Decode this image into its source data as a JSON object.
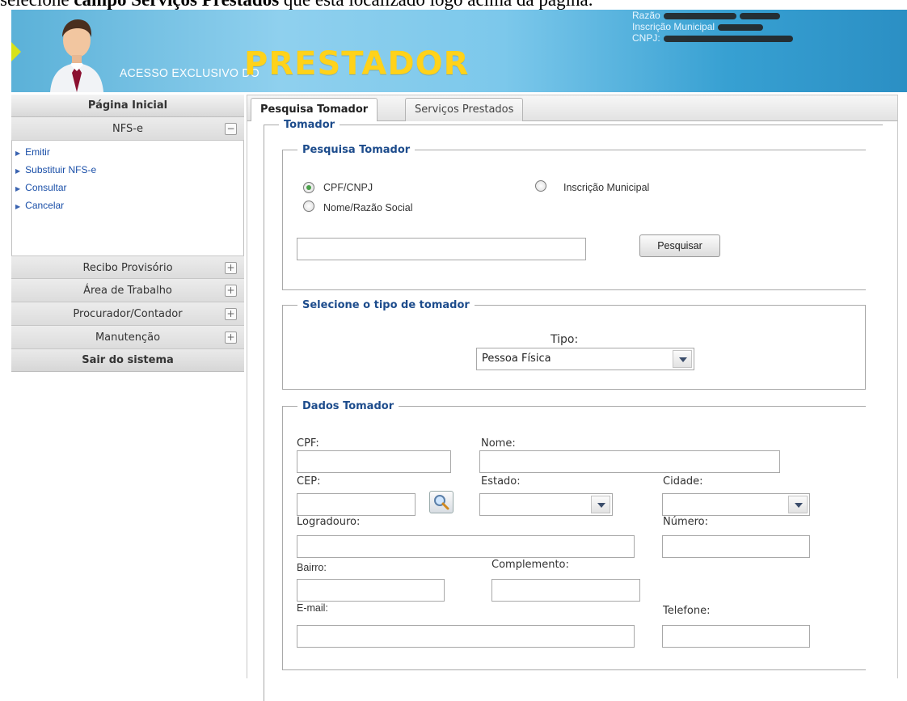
{
  "caption": {
    "prefix": "selecione ",
    "bold": "campo Serviços Prestados",
    "suffix": " que está localizado logo acima da página."
  },
  "banner": {
    "tagline": "ACESSO EXCLUSIVO DO",
    "brand": "PRESTADOR",
    "info": [
      "Razão",
      "Inscrição Municipal",
      "CNPJ:"
    ]
  },
  "sidebar": {
    "home": "Página Inicial",
    "nfse": {
      "label": "NFS-e",
      "toggle": "−"
    },
    "nfse_links": [
      "Emitir",
      "Substituir NFS-e",
      "Consultar",
      "Cancelar"
    ],
    "sections": [
      {
        "label": "Recibo Provisório",
        "toggle": "+"
      },
      {
        "label": "Área de Trabalho",
        "toggle": "+"
      },
      {
        "label": "Procurador/Contador",
        "toggle": "+"
      },
      {
        "label": "Manutenção",
        "toggle": "+"
      }
    ],
    "exit": "Sair do sistema"
  },
  "tabs": {
    "active": "Pesquisa Tomador",
    "other": "Serviços Prestados"
  },
  "tomador": {
    "legend": "Tomador",
    "pesquisa": {
      "legend": "Pesquisa Tomador",
      "opt_cpf": "CPF/CNPJ",
      "opt_insc": "Inscrição Municipal",
      "opt_nome": "Nome/Razão Social",
      "search_value": "",
      "button": "Pesquisar"
    },
    "tipo": {
      "legend": "Selecione o tipo de tomador",
      "label": "Tipo:",
      "value": "Pessoa Física"
    },
    "dados": {
      "legend": "Dados Tomador",
      "cpf": "CPF:",
      "nome": "Nome:",
      "cep": "CEP:",
      "estado": "Estado:",
      "cidade": "Cidade:",
      "logradouro": "Logradouro:",
      "numero": "Número:",
      "bairro": "Bairro:",
      "complemento": "Complemento:",
      "email": "E-mail:",
      "telefone": "Telefone:"
    }
  }
}
